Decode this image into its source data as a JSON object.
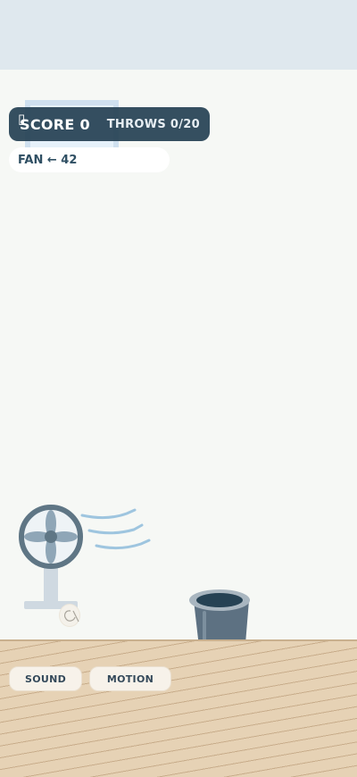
{
  "hud": {
    "score_label": "SCORE 0",
    "throws_label": "THROWS 0/20",
    "menu_icon": "menu-icon"
  },
  "fan": {
    "label": "FAN ← 42"
  },
  "controls": {
    "sound_label": "SOUND",
    "motion_label": "MOTION"
  },
  "colors": {
    "hud_bg": "#264254",
    "wall": "#f6f8f5",
    "sky_band": "#dfe8ee",
    "fan_body": "#5f7685",
    "fan_blades": "#8fa6b7",
    "air_streaks": "#9ec5df",
    "bin": "#5d7182",
    "floor": "#e6d2b5"
  }
}
